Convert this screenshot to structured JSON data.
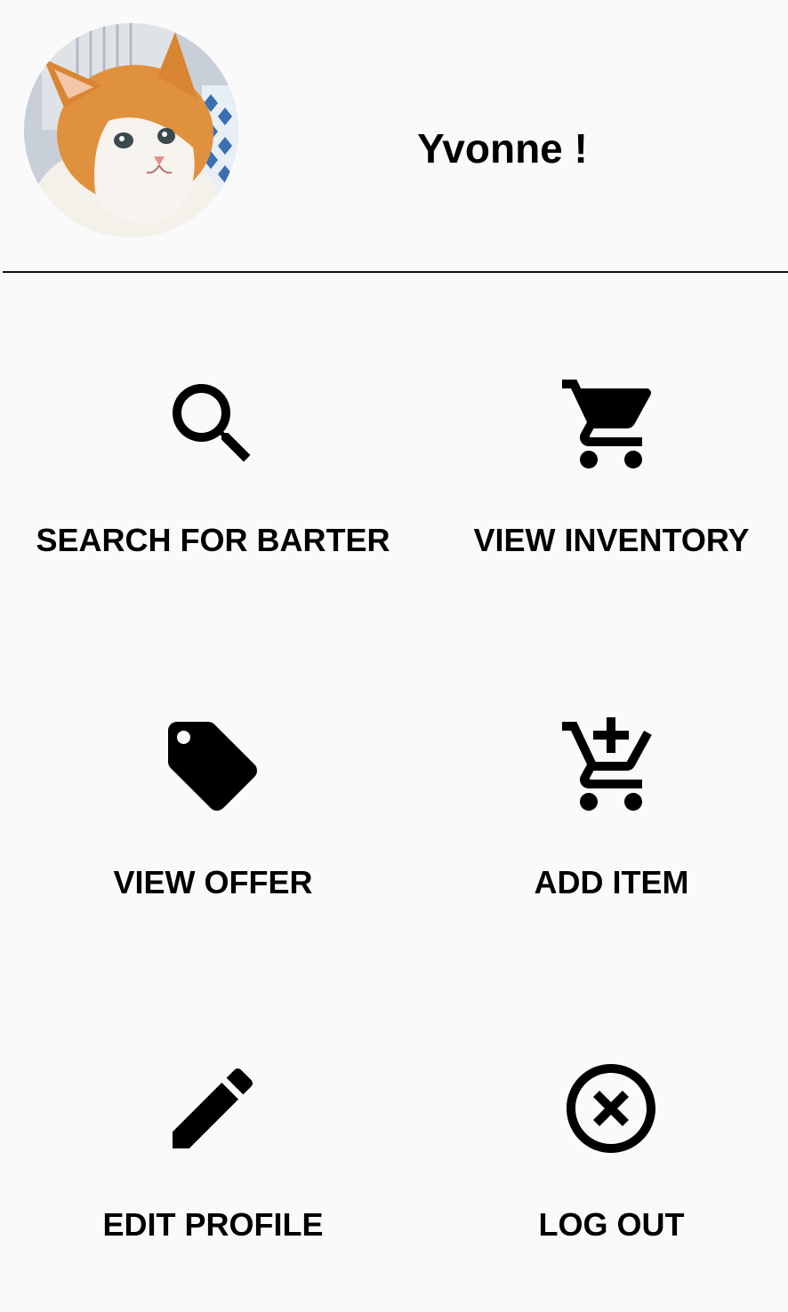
{
  "header": {
    "greeting": "Yvonne !"
  },
  "menu": {
    "items": [
      {
        "label": "SEARCH FOR BARTER",
        "icon": "search-icon"
      },
      {
        "label": "VIEW INVENTORY",
        "icon": "shopping-cart-icon"
      },
      {
        "label": "VIEW OFFER",
        "icon": "tag-icon"
      },
      {
        "label": "ADD ITEM",
        "icon": "add-shopping-cart-icon"
      },
      {
        "label": "EDIT PROFILE",
        "icon": "pencil-icon"
      },
      {
        "label": "LOG OUT",
        "icon": "cancel-circle-icon"
      }
    ]
  },
  "colors": {
    "background": "#fafafa",
    "text": "#000000",
    "divider": "#111111"
  }
}
